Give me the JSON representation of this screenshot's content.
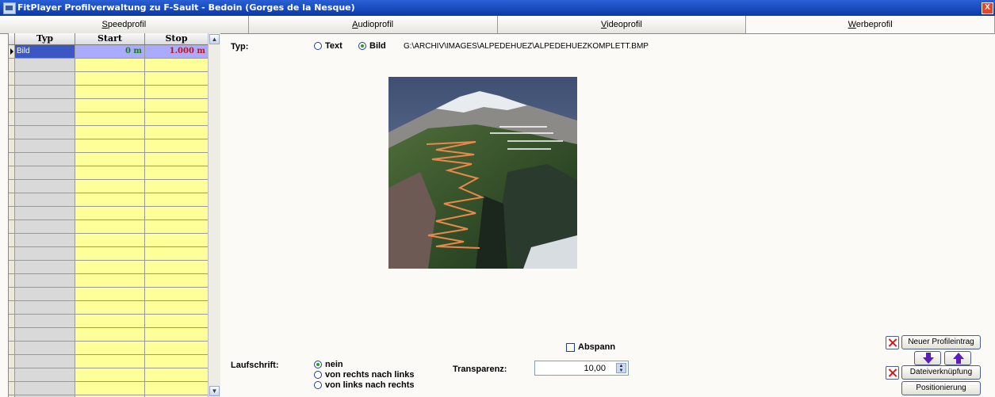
{
  "window": {
    "title": "FitPlayer Profilverwaltung zu F-Sault - Bedoin (Gorges de la Nesque)",
    "close_label": "X"
  },
  "tabs": [
    {
      "first": "S",
      "rest": "peedprofil"
    },
    {
      "first": "A",
      "rest": "udioprofil"
    },
    {
      "first": "V",
      "rest": "ideoprofil"
    },
    {
      "first": "W",
      "rest": "erbeprofil"
    }
  ],
  "grid": {
    "columns": [
      "Typ",
      "Start",
      "Stop"
    ],
    "rows": [
      {
        "typ": "Bild",
        "start": "0 m",
        "stop": "1.000 m"
      }
    ]
  },
  "form": {
    "typ_label": "Typ:",
    "typ_options": [
      "Text",
      "Bild"
    ],
    "typ_selected": "Bild",
    "file_path": "G:\\ARCHIV\\IMAGES\\ALPEDEHUEZ\\ALPEDEHUEZKOMPLETT.BMP",
    "laufschrift_label": "Laufschrift:",
    "laufschrift_options": [
      "nein",
      "von rechts nach links",
      "von links nach rechts"
    ],
    "laufschrift_selected": "nein",
    "abspann_label": "Abspann",
    "transparenz_label": "Transparenz:",
    "transparenz_value": "10,00"
  },
  "buttons": {
    "neuer": "Neuer Profileintrag",
    "datei": "Dateiverknüpfung",
    "positionierung": "Positionierung"
  },
  "colors": {
    "title_bar": "#0a3aa8",
    "cell_yellow": "#ffff99",
    "selected_row": "#aaaaff",
    "start_value": "#1a7a1a",
    "stop_value": "#c0141a",
    "route": "#e8884a"
  }
}
